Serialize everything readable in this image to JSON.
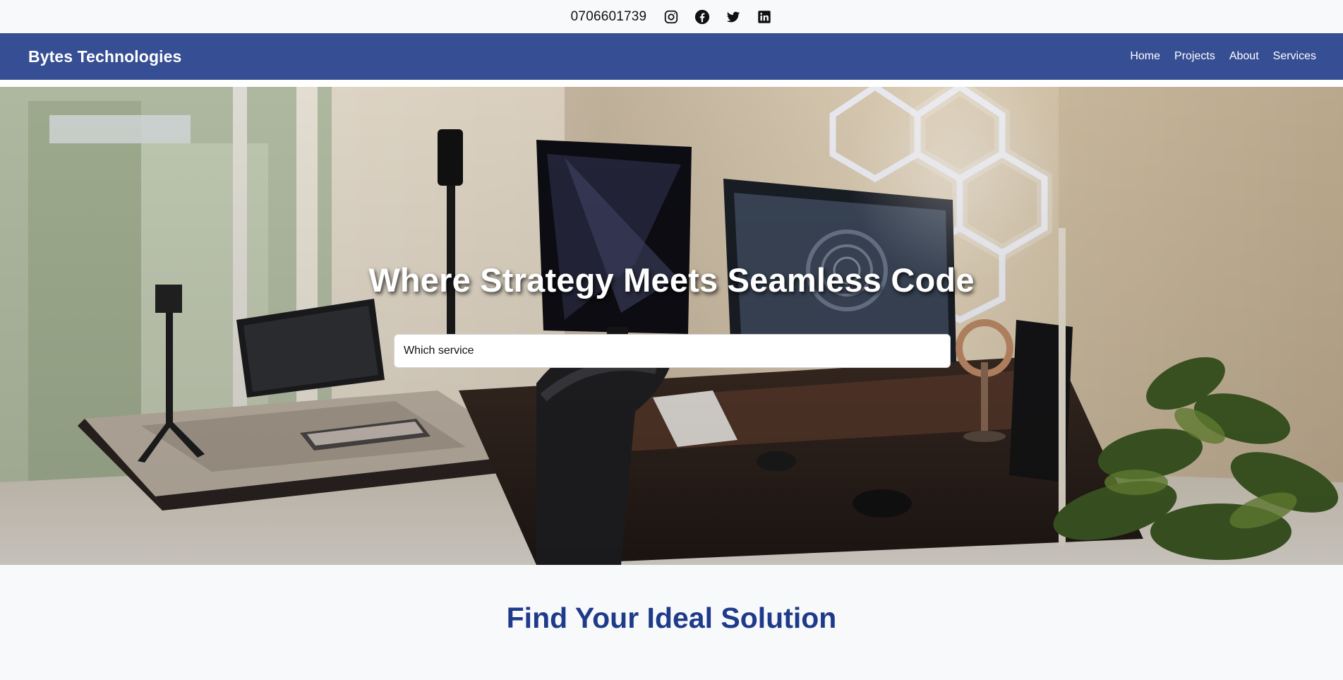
{
  "topbar": {
    "phone": "0706601739",
    "social": [
      {
        "name": "instagram-icon"
      },
      {
        "name": "facebook-icon"
      },
      {
        "name": "twitter-icon"
      },
      {
        "name": "linkedin-icon"
      }
    ]
  },
  "navbar": {
    "brand": "Bytes Technologies",
    "links": [
      "Home",
      "Projects",
      "About",
      "Services"
    ],
    "background": "#364f94"
  },
  "hero": {
    "title": "Where Strategy Meets Seamless Code",
    "search_placeholder": "Which service"
  },
  "find": {
    "title": "Find Your Ideal Solution",
    "color": "#1e3a8a"
  }
}
